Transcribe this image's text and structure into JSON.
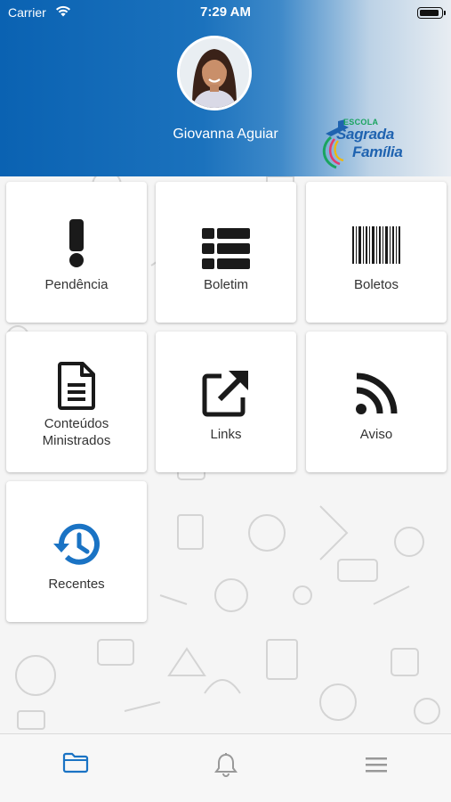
{
  "status_bar": {
    "carrier": "Carrier",
    "time": "7:29 AM"
  },
  "profile": {
    "name": "Giovanna Aguiar"
  },
  "logo": {
    "line1": "ESCOLA",
    "line2": "Sagrada",
    "line3": "Família"
  },
  "menu": {
    "pendencia": "Pendência",
    "boletim": "Boletim",
    "boletos": "Boletos",
    "conteudos_line1": "Conteúdos",
    "conteudos_line2": "Ministrados",
    "links": "Links",
    "aviso": "Aviso",
    "recentes": "Recentes"
  },
  "tabs": {
    "active": "folder",
    "items": [
      "folder-icon",
      "bell-icon",
      "menu-icon"
    ]
  },
  "colors": {
    "header_blue": "#0a62b2",
    "active_tab": "#1a73c4",
    "recent_icon": "#1a73c4",
    "icon_dark": "#1a1a1a"
  }
}
